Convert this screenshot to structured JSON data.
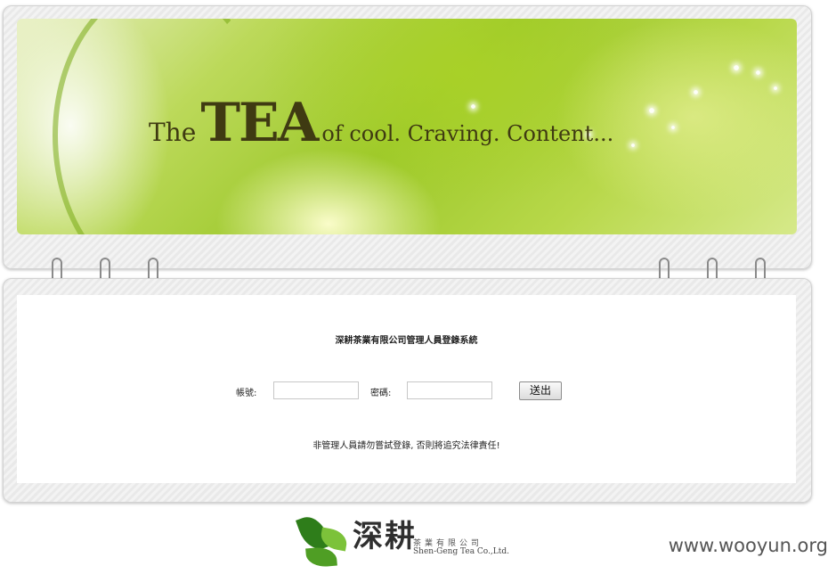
{
  "banner": {
    "the": "The",
    "tea": "TEA",
    "rest": "of cool. Craving. Content..."
  },
  "login": {
    "title": "深耕茶業有限公司管理人員登錄系統",
    "account_label": "帳號:",
    "password_label": "密碼:",
    "account_value": "",
    "password_value": "",
    "submit_label": "送出",
    "warning": "非管理人員請勿嘗試登錄, 否則將追究法律責任!"
  },
  "footer": {
    "logo_cn": "深耕",
    "logo_sub": "茶業有限公司",
    "logo_en": "Shen-Geng Tea Co.,Ltd."
  },
  "watermark": "www.wooyun.org",
  "colors": {
    "banner_green": "#9cc82a",
    "leaf_dark": "#2e7d1a",
    "leaf_light": "#7cc23a"
  }
}
